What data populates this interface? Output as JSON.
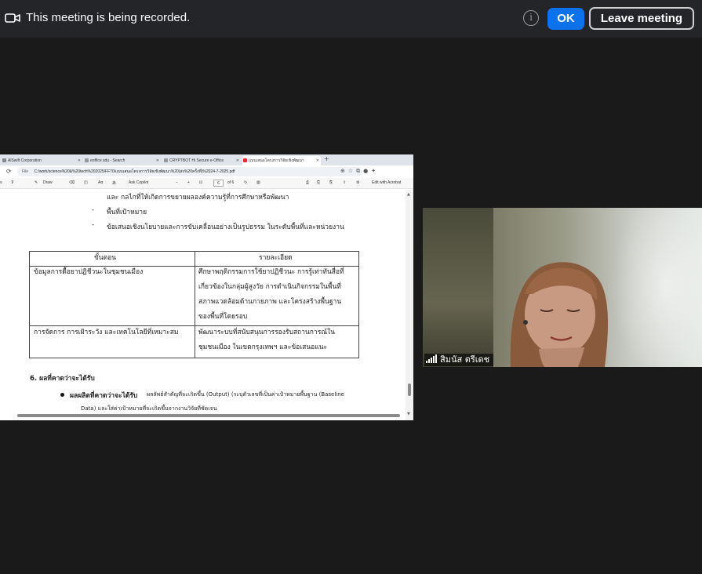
{
  "banner": {
    "recording_text": "This meeting is being recorded.",
    "info_symbol": "i",
    "ok_label": "OK",
    "leave_label": "Leave meeting"
  },
  "browser": {
    "tabs": [
      {
        "label": "AlSwift Corporation",
        "icon": "page-icon"
      },
      {
        "label": "eoffice sdu - Search",
        "icon": "search-icon"
      },
      {
        "label": "CRYPTBOT Hi Secure e-Office",
        "icon": "page-icon"
      },
      {
        "label": "แบบเสนอโครงการวิจัยเชิงพัฒนา",
        "icon": "pdf-icon",
        "active": true
      }
    ],
    "new_tab": "+",
    "address_label": "File",
    "address": "C:/work/science%20&%20tech%202025/FF70/แบบเสนอโครงการวิจัยเชิงพัฒนา%20(ส่ง%20ครั้งที่)%2024-7-2025.pdf",
    "pdf_toolbar": {
      "draw": "Draw",
      "read_aloud": "Aα",
      "ask_copilot": "Ask Copilot",
      "zoom_out": "−",
      "zoom_in": "+",
      "page_current": "6",
      "page_total": "of 6",
      "edit_acrobat": "Edit with Acrobat"
    }
  },
  "document": {
    "line1": "และ กลไกที่ให้เกิดการขยายผลองค์ความรู้ที่การศึกษาหรือพัฒนา",
    "line2_dash": "-",
    "line2": "พื้นที่เป้าหมาย",
    "line3_dash": "-",
    "line3": "ข้อเสนอเชิงนโยบายและการขับเคลื่อนอย่างเป็นรูปธรรม ในระดับพื้นที่และหน่วยงาน",
    "table": {
      "headers": [
        "ขั้นตอน",
        "รายละเอียด"
      ],
      "rows": [
        {
          "step": "ข้อมูลการดื้อยาปฏิชีวนะในชุมชนเมือง",
          "detail": [
            "ศึกษาพฤติกรรมการใช้ยาปฏิชีวนะ การรู้เท่าทันสื่อที่",
            "เกี่ยวข้องในกลุ่มผู้สูงวัย การดำเนินกิจกรรมในพื้นที่",
            "สภาพแวดล้อมด้านกายภาพ และโครงสร้างพื้นฐาน",
            "ของพื้นที่โดยรอบ"
          ]
        },
        {
          "step": "การจัดการ การเฝ้าระวัง และเทคโนโลยีที่เหมาะสม",
          "detail": [
            "พัฒนาระบบที่สนับสนุนการรองรับสถานการณ์ใน",
            "ชุมชนเมือง ในเขตกรุงเทพฯ และข้อเสนอแนะ"
          ]
        }
      ]
    },
    "section_heading": "6. ผลที่คาดว่าจะได้รับ",
    "bullet_bold": "ผลผลิตที่คาดว่าจะได้รับ",
    "bullet_text": "ผลลัพธ์สำคัญที่จะเกิดขึ้น (Output) (ระบุตัวเลขที่เป็นค่าเป้าหมายพื้นฐาน (Baseline",
    "bullet_cont": "Data) และใส่ค่าเป้าหมายที่จะเกิดขึ้นจากงานวิจัยที่ชัดเจน"
  },
  "participant": {
    "name": "สิมนัส ตรีเดช",
    "signal_icon": "signal-bars-icon"
  },
  "colors": {
    "banner_bg": "#242529",
    "ok_blue": "#0e72ed",
    "meeting_bg": "#1a1a1a"
  }
}
